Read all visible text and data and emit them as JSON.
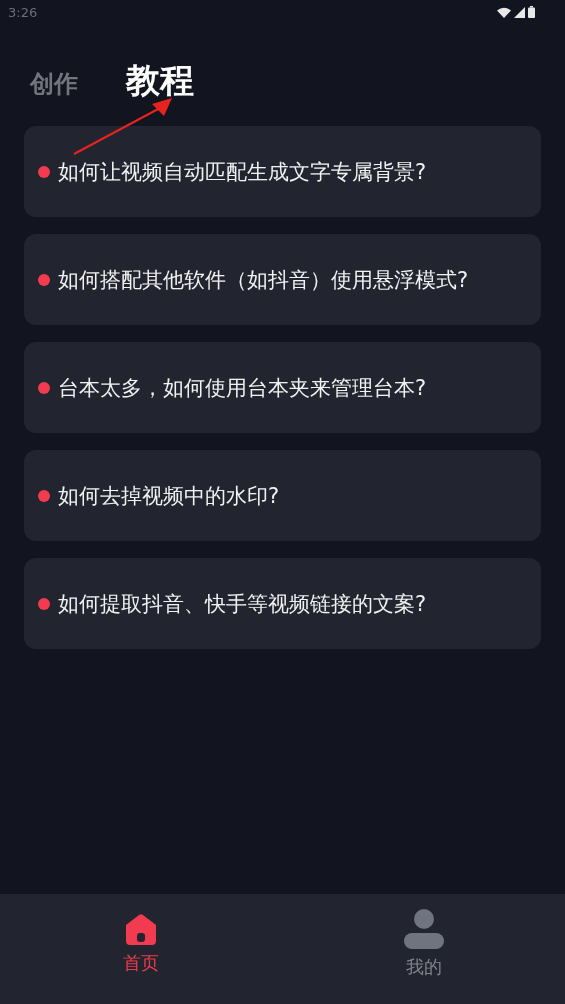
{
  "status_bar": {
    "time": "3:26"
  },
  "tabs": [
    {
      "label": "创作",
      "selected": false
    },
    {
      "label": "教程",
      "selected": true
    }
  ],
  "tutorials": [
    {
      "title": "如何让视频自动匹配生成文字专属背景?"
    },
    {
      "title": "如何搭配其他软件（如抖音）使用悬浮模式?"
    },
    {
      "title": "台本太多，如何使用台本夹来管理台本?"
    },
    {
      "title": "如何去掉视频中的水印?"
    },
    {
      "title": "如何提取抖音、快手等视频链接的文案?"
    }
  ],
  "bottom_nav": [
    {
      "kind": "home",
      "label": "首页",
      "selected": true
    },
    {
      "kind": "profile",
      "label": "我的",
      "selected": false
    }
  ]
}
